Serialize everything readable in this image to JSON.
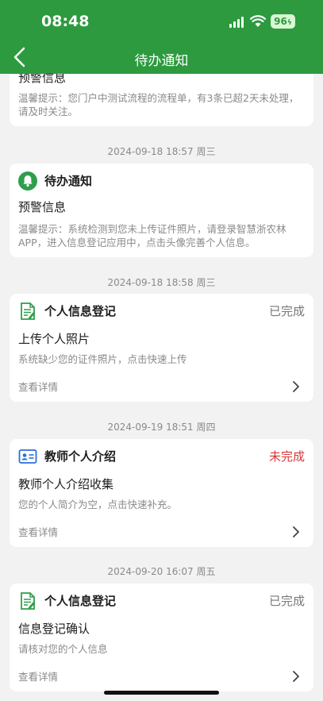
{
  "status_bar": {
    "time": "08:48",
    "battery": "96"
  },
  "nav": {
    "title": "待办通知"
  },
  "colors": {
    "brand_green": "#2d9a3f",
    "incomplete_red": "#d73636"
  },
  "cards": [
    {
      "title": "预警信息",
      "description": "温馨提示：您门户中测试流程的流程单，有3条已超2天未处理，请及时关注。"
    },
    {
      "date": "2024-09-18 18:57 周三",
      "icon": "bell-icon",
      "type": "待办通知",
      "title": "预警信息",
      "description": "温馨提示：系统检测到您未上传证件照片，请登录智慧浙农林APP，进入信息登记应用中，点击头像完善个人信息。"
    },
    {
      "date": "2024-09-18 18:58 周三",
      "icon": "form-icon",
      "type": "个人信息登记",
      "status": "已完成",
      "title": "上传个人照片",
      "description": "系统缺少您的证件照片，点击快速上传",
      "link": "查看详情"
    },
    {
      "date": "2024-09-19 18:51 周四",
      "icon": "id-card-icon",
      "type": "教师个人介绍",
      "status": "未完成",
      "title": "教师个人介绍收集",
      "description": "您的个人简介为空，点击快速补充。",
      "link": "查看详情"
    },
    {
      "date": "2024-09-20 16:07 周五",
      "icon": "form-icon",
      "type": "个人信息登记",
      "status": "已完成",
      "title": "信息登记确认",
      "description": "请核对您的个人信息",
      "link": "查看详情"
    }
  ]
}
